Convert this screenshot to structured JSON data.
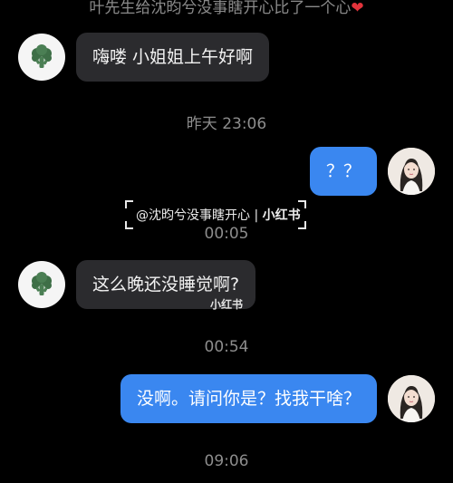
{
  "top_notice": {
    "text": "叶先生给沈昀兮没事瞎开心比了一个心",
    "heart": "❤"
  },
  "messages": [
    {
      "side": "incoming",
      "text": "嗨喽   小姐姐上午好啊",
      "avatar": "broccoli-icon"
    },
    {
      "side": "outgoing",
      "text": "？？",
      "avatar": "girl-avatar"
    },
    {
      "side": "incoming",
      "text": "这么晚还没睡觉啊?",
      "avatar": "broccoli-icon"
    },
    {
      "side": "outgoing",
      "text": "没啊。请问你是？找我干啥？",
      "avatar": "girl-avatar"
    }
  ],
  "timestamps": [
    "昨天 23:06",
    "00:05",
    "00:54",
    "09:06"
  ],
  "watermark": {
    "handle": "@沈昀兮没事瞎开心",
    "separator": "|",
    "brand": "小红书",
    "small_brand": "小红书"
  },
  "colors": {
    "background": "#000000",
    "incoming_bubble": "#2b2b2e",
    "outgoing_bubble": "#3a87f0",
    "timestamp_text": "#8d8d8d",
    "heart": "#e2333b"
  }
}
